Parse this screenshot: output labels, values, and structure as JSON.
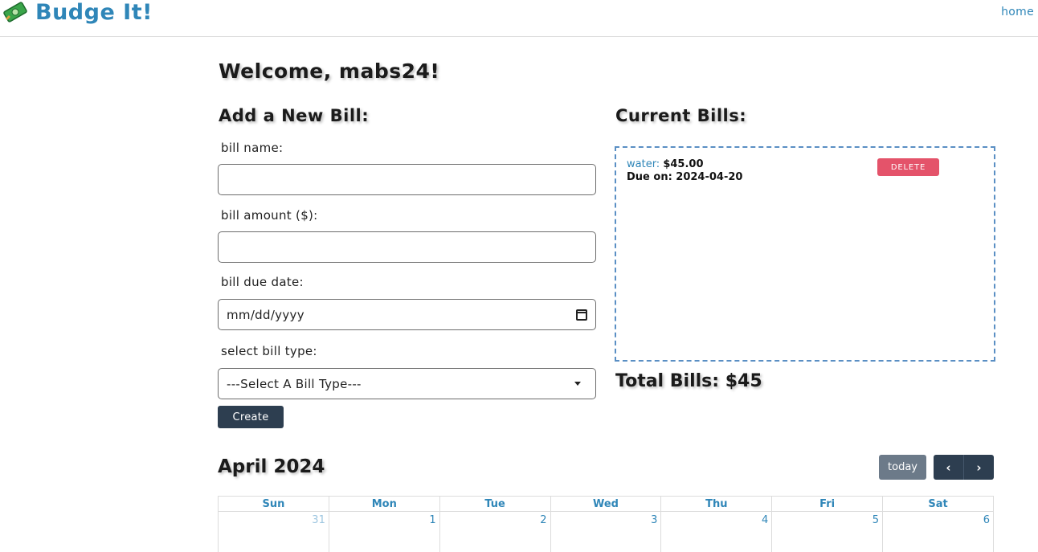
{
  "app": {
    "brand": "Budge It!",
    "nav_home": "home"
  },
  "welcome": "Welcome, mabs24!",
  "add_bill": {
    "title": "Add a New Bill:",
    "name_label": "bill name:",
    "name_value": "",
    "amount_label": "bill amount ($):",
    "amount_value": "",
    "due_label": "bill due date:",
    "due_placeholder": "mm/dd/yyyy",
    "type_label": "select bill type:",
    "type_selected": "---Select A Bill Type---",
    "create_label": "Create"
  },
  "current_bills": {
    "title": "Current Bills:",
    "items": [
      {
        "name": "water:",
        "amount": "$45.00",
        "due": "Due on: 2024-04-20",
        "delete_label": "DELETE"
      }
    ],
    "total": "Total Bills: $45"
  },
  "calendar": {
    "title": "April 2024",
    "today_label": "today",
    "prev_icon": "chevron-left-icon",
    "next_icon": "chevron-right-icon",
    "weekdays": [
      "Sun",
      "Mon",
      "Tue",
      "Wed",
      "Thu",
      "Fri",
      "Sat"
    ],
    "first_week": [
      "31",
      "1",
      "2",
      "3",
      "4",
      "5",
      "6"
    ]
  },
  "colors": {
    "brand": "#2f86b8",
    "dark_button": "#2d3e50",
    "delete_button": "#e4536a",
    "today_button": "#6c7a89"
  }
}
